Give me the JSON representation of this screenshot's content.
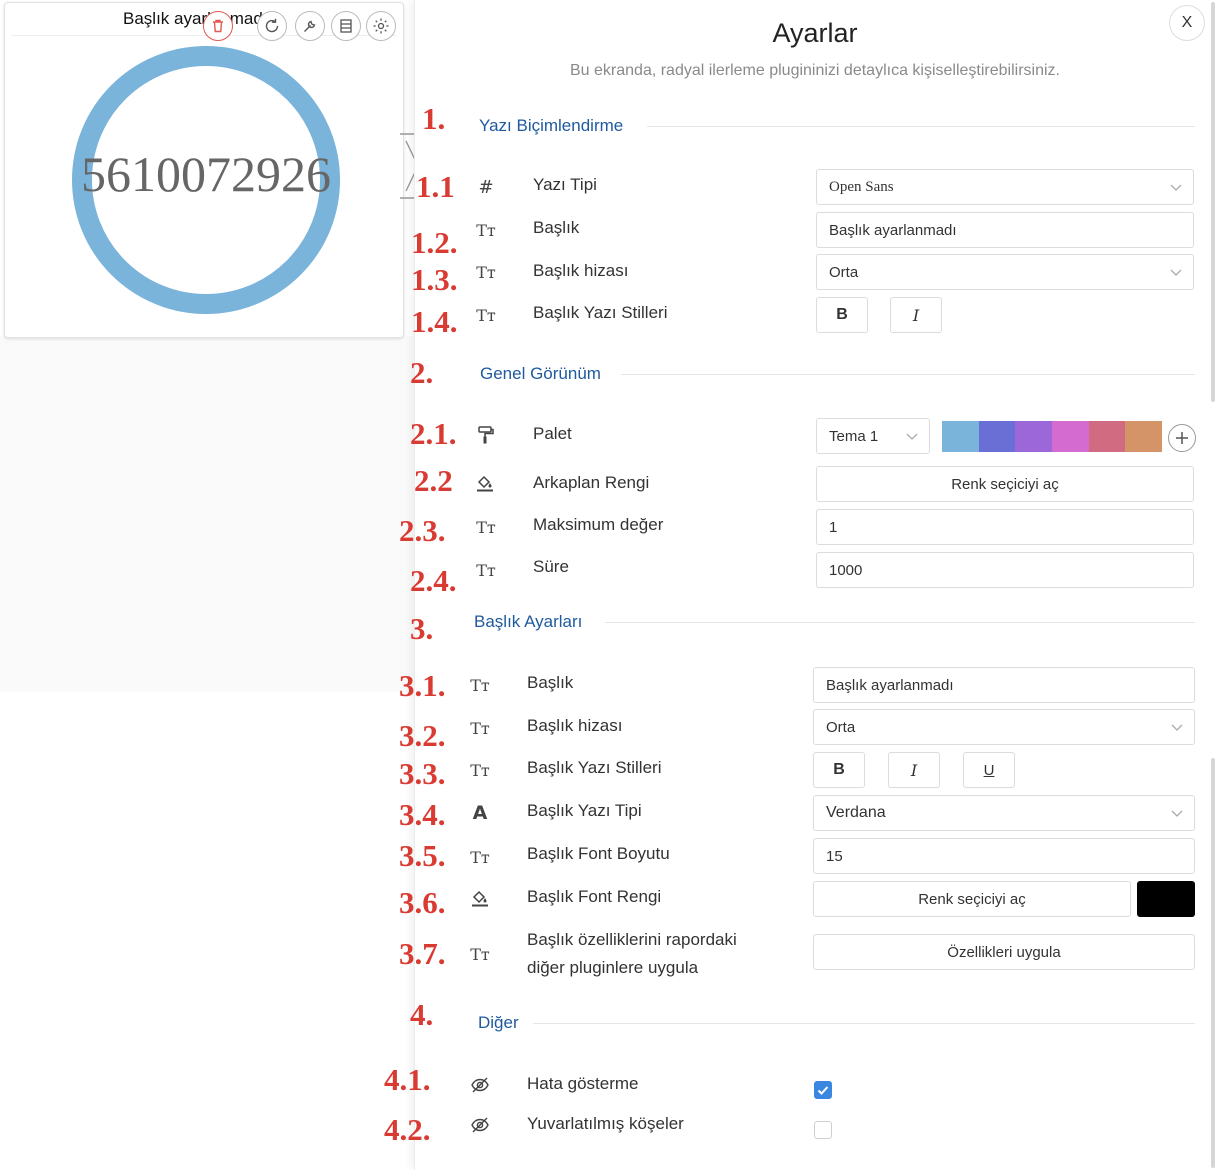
{
  "widget": {
    "title": "Başlık ayarlanmadı",
    "value": "5610072926",
    "ring_color": "#7ab4da"
  },
  "panel": {
    "title": "Ayarlar",
    "subtitle": "Bu ekranda, radyal ilerleme plugininizi detaylıca kişiselleştirebilirsiniz.",
    "close_label": "X"
  },
  "sections": {
    "s1": "Yazı Biçimlendirme",
    "s2": "Genel Görünüm",
    "s3": "Başlık Ayarları",
    "s4": "Diğer"
  },
  "rows": {
    "font_label": "Yazı Tipi",
    "font_value": "Open Sans",
    "title_label": "Başlık",
    "title_value": "Başlık ayarlanmadı",
    "align_label": "Başlık hizası",
    "align_value": "Orta",
    "styles_label": "Başlık Yazı Stilleri",
    "bold": "B",
    "italic": "I",
    "underline": "U",
    "palette_label": "Palet",
    "palette_value": "Tema 1",
    "bg_label": "Arkaplan Rengi",
    "color_picker": "Renk seçiciyi aç",
    "max_label": "Maksimum değer",
    "max_value": "1",
    "dur_label": "Süre",
    "dur_value": "1000",
    "t_title_label": "Başlık",
    "t_title_value": "Başlık ayarlanmadı",
    "t_align_label": "Başlık hizası",
    "t_align_value": "Orta",
    "t_styles_label": "Başlık Yazı Stilleri",
    "t_font_label": "Başlık Yazı Tipi",
    "t_font_value": "Verdana",
    "t_size_label": "Başlık Font Boyutu",
    "t_size_value": "15",
    "t_color_label": "Başlık Font Rengi",
    "t_color_value": "#000000",
    "t_apply_label_1": "Başlık özelliklerini rapordaki",
    "t_apply_label_2": "diğer pluginlere uygula",
    "t_apply_button": "Özellikleri uygula",
    "err_label": "Hata gösterme",
    "err_checked": true,
    "round_label": "Yuvarlatılmış köşeler",
    "round_checked": false
  },
  "palette_colors": [
    "#7ab4da",
    "#6a6fd6",
    "#9b67d9",
    "#d46bd0",
    "#d16b82",
    "#d59467"
  ],
  "annotations": [
    "1.",
    "1.1",
    "1.2.",
    "1.3.",
    "1.4.",
    "2.",
    "2.1.",
    "2.2",
    "2.3.",
    "2.4.",
    "3.",
    "3.1.",
    "3.2.",
    "3.3.",
    "3.4.",
    "3.5.",
    "3.6.",
    "3.7.",
    "4.",
    "4.1.",
    "4.2."
  ],
  "accent": "#1f5a9e",
  "annotation_color": "#d93a32"
}
